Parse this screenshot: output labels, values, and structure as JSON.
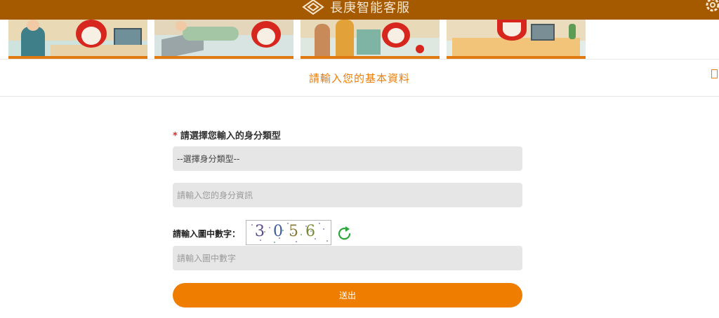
{
  "header": {
    "brand_name": "長庚智能客服",
    "logo_icon": "chang-gung-logo-icon",
    "settings_icon": "gear-icon"
  },
  "banner": {
    "scenes": [
      "clinic-doctor-scene",
      "hospital-bed-scene",
      "family-scene",
      "service-desk-scene"
    ]
  },
  "modal": {
    "title": "請輸入您的基本資料",
    "close_icon": "close-box-icon",
    "identity_type": {
      "required_mark": "*",
      "label": "請選擇您輸入的身分類型",
      "selected": "--選擇身分類型--"
    },
    "identity_info": {
      "placeholder": "請輸入您的身分資訊",
      "value": ""
    },
    "captcha": {
      "label": "請輸入圖中數字：",
      "digits": [
        "3",
        "0",
        "5",
        "6"
      ],
      "refresh_icon": "refresh-icon",
      "input_placeholder": "請輸入圖中數字",
      "input_value": ""
    },
    "submit_label": "送出"
  },
  "colors": {
    "accent": "#ee7d00",
    "header_bg": "#a65a00",
    "field_bg": "#e6e6e6",
    "required": "#e32b2b",
    "refresh": "#2aa63a"
  }
}
